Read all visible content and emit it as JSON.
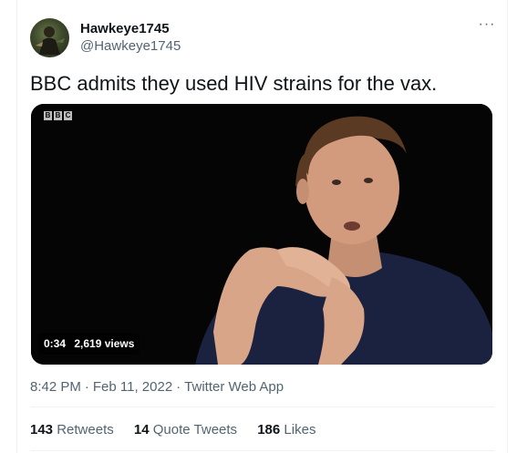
{
  "user": {
    "display_name": "Hawkeye1745",
    "handle": "@Hawkeye1745",
    "avatar_icon": "avatar-icon"
  },
  "menu": {
    "more_icon": "ellipsis-icon",
    "more_glyph": "···"
  },
  "tweet": {
    "text": "BBC admits they used HIV strains for the vax."
  },
  "media": {
    "logo_letters": [
      "B",
      "B",
      "C"
    ],
    "duration": "0:34",
    "views": "2,619 views"
  },
  "meta": {
    "time": "8:42 PM",
    "separator": "·",
    "date": "Feb 11, 2022",
    "source": "Twitter Web App"
  },
  "stats": {
    "retweets_count": "143",
    "retweets_label": "Retweets",
    "quotes_count": "14",
    "quotes_label": "Quote Tweets",
    "likes_count": "186",
    "likes_label": "Likes"
  },
  "colors": {
    "text_primary": "#0f1419",
    "text_secondary": "#536471",
    "divider": "#eff3f4",
    "media_bg": "#050505"
  }
}
